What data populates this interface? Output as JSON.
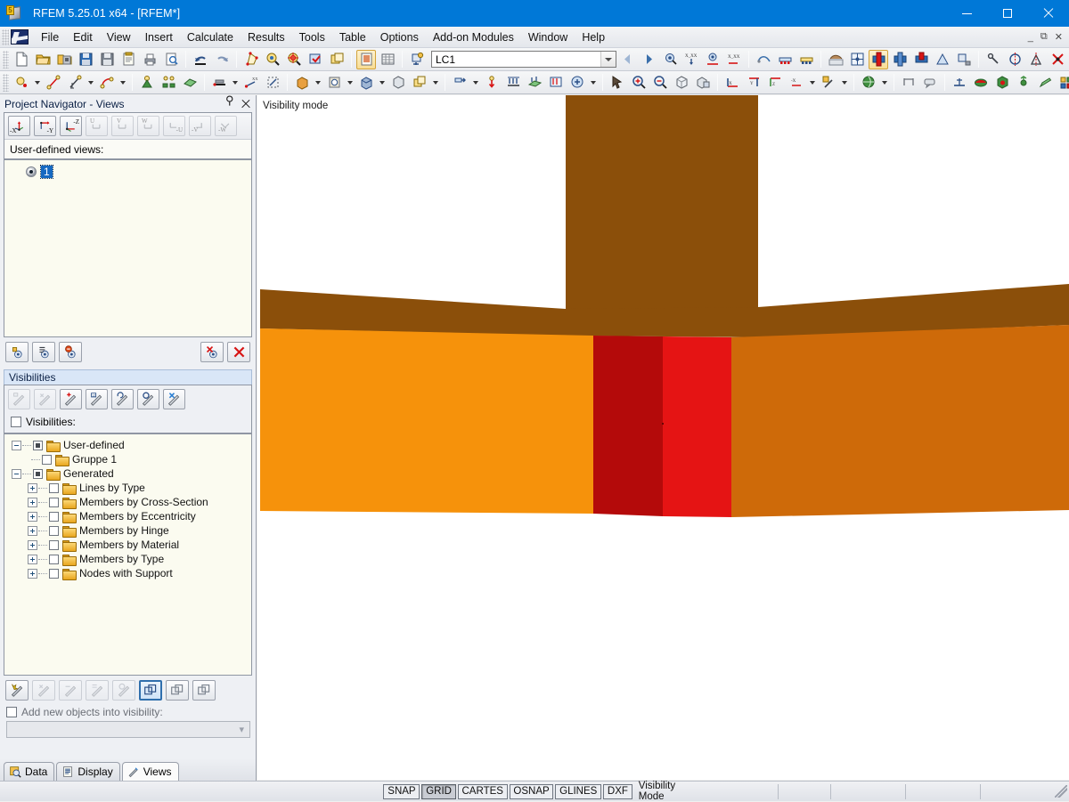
{
  "window": {
    "title": "RFEM 5.25.01 x64 - [RFEM*]",
    "icon": "rfem-app-icon",
    "controls": {
      "minimize": "minimize-button",
      "maximize": "maximize-button",
      "close": "close-button"
    },
    "mdi_controls": {
      "restore": "mdi-restore",
      "minimize": "mdi-minimize",
      "close": "mdi-close"
    }
  },
  "menu": {
    "items": [
      {
        "label": "File",
        "accel": "F"
      },
      {
        "label": "Edit",
        "accel": "E"
      },
      {
        "label": "View",
        "accel": "V"
      },
      {
        "label": "Insert",
        "accel": "I"
      },
      {
        "label": "Calculate",
        "accel": "C"
      },
      {
        "label": "Results",
        "accel": "R"
      },
      {
        "label": "Tools",
        "accel": "T"
      },
      {
        "label": "Table",
        "accel": "b"
      },
      {
        "label": "Options",
        "accel": "O"
      },
      {
        "label": "Add-on Modules",
        "accel": "A"
      },
      {
        "label": "Window",
        "accel": "W"
      },
      {
        "label": "Help",
        "accel": "H"
      }
    ]
  },
  "toolbar_main": {
    "load_case": {
      "value": "LC1",
      "placeholder": "",
      "name": "load-case-combo"
    },
    "icons": [
      "new-document-icon",
      "open-folder-icon",
      "open-project-icon",
      "save-project-icon",
      "save-icon",
      "clipboard-icon",
      "print-icon",
      "print-preview-icon",
      "undo-icon",
      "redo-icon",
      "edit-model-icon",
      "zoom-select-icon",
      "zoom-target-icon",
      "apply-view-icon",
      "copy-window-icon",
      "tables-icon",
      "grid-table-icon",
      "load-case-add-icon"
    ],
    "icons_right": [
      "previous-lc-icon",
      "next-lc-icon",
      "result-values-icon",
      "result-axis-icon",
      "result-view-icon",
      "xx-values-icon",
      "deformation-icon",
      "support-reactions-icon",
      "support-forces-icon",
      "render-shading-icon",
      "wireframe-icon",
      "visibility-mode-icon",
      "visibility-plane-icon",
      "visibility-cut-icon",
      "grid-visibility-icon",
      "clipping-plane-icon",
      "snap-icon",
      "symmetry-icon",
      "mirror-icon",
      "delete-cross-icon",
      "info-icon",
      "printout-icon",
      "report-icon"
    ],
    "active_icon": "visibility-mode-icon"
  },
  "toolbar_secondary": {
    "icons": [
      "node-icon",
      "line-icon",
      "line-dim-icon",
      "arc-icon",
      "support-icon",
      "nodal-support-icon",
      "surface-icon",
      "member-icon",
      "member-xx-icon",
      "member-set-icon",
      "solid-icon",
      "opening-icon",
      "solid-contact-icon",
      "cube-icon",
      "thickness-icon",
      "load-icon",
      "nodal-load-icon",
      "member-load-icon",
      "surface-load-icon",
      "free-load-icon",
      "load-wizard-icon",
      "select-objects-icon",
      "zoom-in-icon",
      "zoom-out-icon",
      "render-cube-icon",
      "render-solid-icon",
      "view-x-icon",
      "view-y-icon",
      "view-z-icon",
      "view-minus-x-icon",
      "display-properties-icon",
      "globe-render-icon",
      "dimension-icon",
      "annotation-icon",
      "section-icon",
      "color-surface-icon",
      "solid-color-icon",
      "node-results-icon",
      "pen-icon",
      "panel-icon",
      "axis-result-icon",
      "table-results-icon"
    ]
  },
  "navigator": {
    "title": "Project Navigator - Views",
    "pin_icon": "pin-icon",
    "close_icon": "close-icon",
    "view_buttons": [
      {
        "name": "view-minus-x-button",
        "label": "-X",
        "enabled": true
      },
      {
        "name": "view-minus-y-button",
        "label": "-Y",
        "enabled": true
      },
      {
        "name": "view-minus-z-button",
        "label": "-Z",
        "enabled": true
      },
      {
        "name": "view-u-button",
        "label": "U",
        "enabled": false
      },
      {
        "name": "view-v-button",
        "label": "V",
        "enabled": false
      },
      {
        "name": "view-w-button",
        "label": "W",
        "enabled": false
      },
      {
        "name": "view-minus-u-button",
        "label": "-U",
        "enabled": false
      },
      {
        "name": "view-minus-v-button",
        "label": "-V",
        "enabled": false
      },
      {
        "name": "view-minus-w-button",
        "label": "-W",
        "enabled": false
      }
    ],
    "user_views_label": "User-defined views:",
    "user_views": [
      {
        "name": "1",
        "selected": true
      }
    ],
    "views_actions": [
      {
        "name": "new-view-button",
        "icon": "add-view-icon"
      },
      {
        "name": "edit-view-button",
        "icon": "edit-view-icon"
      },
      {
        "name": "refresh-view-button",
        "icon": "refresh-view-icon"
      },
      {
        "name": "delete-view-button",
        "icon": "delete-view-icon"
      },
      {
        "name": "remove-all-views-button",
        "icon": "red-x-icon"
      }
    ]
  },
  "visibilities": {
    "header": "Visibilities",
    "toolbar": [
      {
        "name": "visibility-new-button",
        "icon": "visibility-new-icon",
        "enabled": false
      },
      {
        "name": "visibility-all-button",
        "icon": "visibility-all-icon",
        "enabled": false
      },
      {
        "name": "visibility-add-button",
        "icon": "visibility-add-icon",
        "enabled": true
      },
      {
        "name": "visibility-numbering-button",
        "icon": "visibility-number-icon",
        "enabled": true
      },
      {
        "name": "visibility-invert-button",
        "icon": "visibility-invert-icon",
        "enabled": true
      },
      {
        "name": "visibility-apply-button",
        "icon": "visibility-apply-icon",
        "enabled": true
      },
      {
        "name": "visibility-cancel-button",
        "icon": "visibility-cancel-icon",
        "enabled": true
      }
    ],
    "checkbox_label": "Visibilities:",
    "checkbox_checked": false,
    "tree": [
      {
        "label": "User-defined",
        "depth": 0,
        "expander": "minus",
        "checkbox": "partial",
        "folder": true
      },
      {
        "label": "Gruppe 1",
        "depth": 1,
        "expander": "none",
        "checkbox": "empty",
        "folder": true
      },
      {
        "label": "Generated",
        "depth": 0,
        "expander": "minus",
        "checkbox": "partial",
        "folder": true
      },
      {
        "label": "Lines by Type",
        "depth": 1,
        "expander": "plus",
        "checkbox": "empty",
        "folder": true
      },
      {
        "label": "Members by Cross-Section",
        "depth": 1,
        "expander": "plus",
        "checkbox": "empty",
        "folder": true
      },
      {
        "label": "Members by Eccentricity",
        "depth": 1,
        "expander": "plus",
        "checkbox": "empty",
        "folder": true
      },
      {
        "label": "Members by Hinge",
        "depth": 1,
        "expander": "plus",
        "checkbox": "empty",
        "folder": true
      },
      {
        "label": "Members by Material",
        "depth": 1,
        "expander": "plus",
        "checkbox": "empty",
        "folder": true
      },
      {
        "label": "Members by Type",
        "depth": 1,
        "expander": "plus",
        "checkbox": "empty",
        "folder": true
      },
      {
        "label": "Nodes with Support",
        "depth": 1,
        "expander": "plus",
        "checkbox": "empty",
        "folder": true
      }
    ],
    "bottom_toolbar": [
      {
        "name": "visibility-create-button",
        "icon": "visibility-create-icon",
        "enabled": true,
        "selected": false
      },
      {
        "name": "visibility-edit-button",
        "icon": "visibility-edit-icon",
        "enabled": false,
        "selected": false
      },
      {
        "name": "visibility-hide-button",
        "icon": "visibility-hide-icon",
        "enabled": false,
        "selected": false
      },
      {
        "name": "visibility-show-button",
        "icon": "visibility-show-icon",
        "enabled": false,
        "selected": false
      },
      {
        "name": "visibility-check-button",
        "icon": "visibility-check-icon",
        "enabled": false,
        "selected": false
      },
      {
        "name": "visibility-mode-single-button",
        "icon": "layers-single-icon",
        "enabled": true,
        "selected": true
      },
      {
        "name": "visibility-mode-multi-button",
        "icon": "layers-multi-icon",
        "enabled": true,
        "selected": false
      },
      {
        "name": "visibility-mode-all-button",
        "icon": "layers-all-icon",
        "enabled": true,
        "selected": false
      }
    ],
    "add_objects_label": "Add new objects into visibility:",
    "add_objects_checked": false,
    "add_objects_value": ""
  },
  "left_tabs": [
    {
      "label": "Data",
      "icon": "data-icon",
      "active": false
    },
    {
      "label": "Display",
      "icon": "display-icon",
      "active": false
    },
    {
      "label": "Views",
      "icon": "views-icon",
      "active": true
    }
  ],
  "viewport": {
    "label": "Visibility mode",
    "background": "#ffffff",
    "model": {
      "description": "Rendered beam-column joint, front view",
      "parts": [
        {
          "name": "column",
          "color": "#8B4F0A"
        },
        {
          "name": "beam-top-flange",
          "color": "#8B4F0A"
        },
        {
          "name": "beam-left-web",
          "color": "#F6920B"
        },
        {
          "name": "beam-right-web",
          "color": "#CE6A09"
        },
        {
          "name": "joint-plate-dark-red",
          "color": "#B40A0A"
        },
        {
          "name": "joint-plate-red",
          "color": "#E51414"
        }
      ]
    }
  },
  "statusbar": {
    "buttons": [
      {
        "label": "SNAP",
        "pressed": false
      },
      {
        "label": "GRID",
        "pressed": true
      },
      {
        "label": "CARTES",
        "pressed": false
      },
      {
        "label": "OSNAP",
        "pressed": false
      },
      {
        "label": "GLINES",
        "pressed": false
      },
      {
        "label": "DXF",
        "pressed": false
      }
    ],
    "mode": "Visibility Mode",
    "cells": [
      "",
      "",
      "",
      ""
    ]
  }
}
